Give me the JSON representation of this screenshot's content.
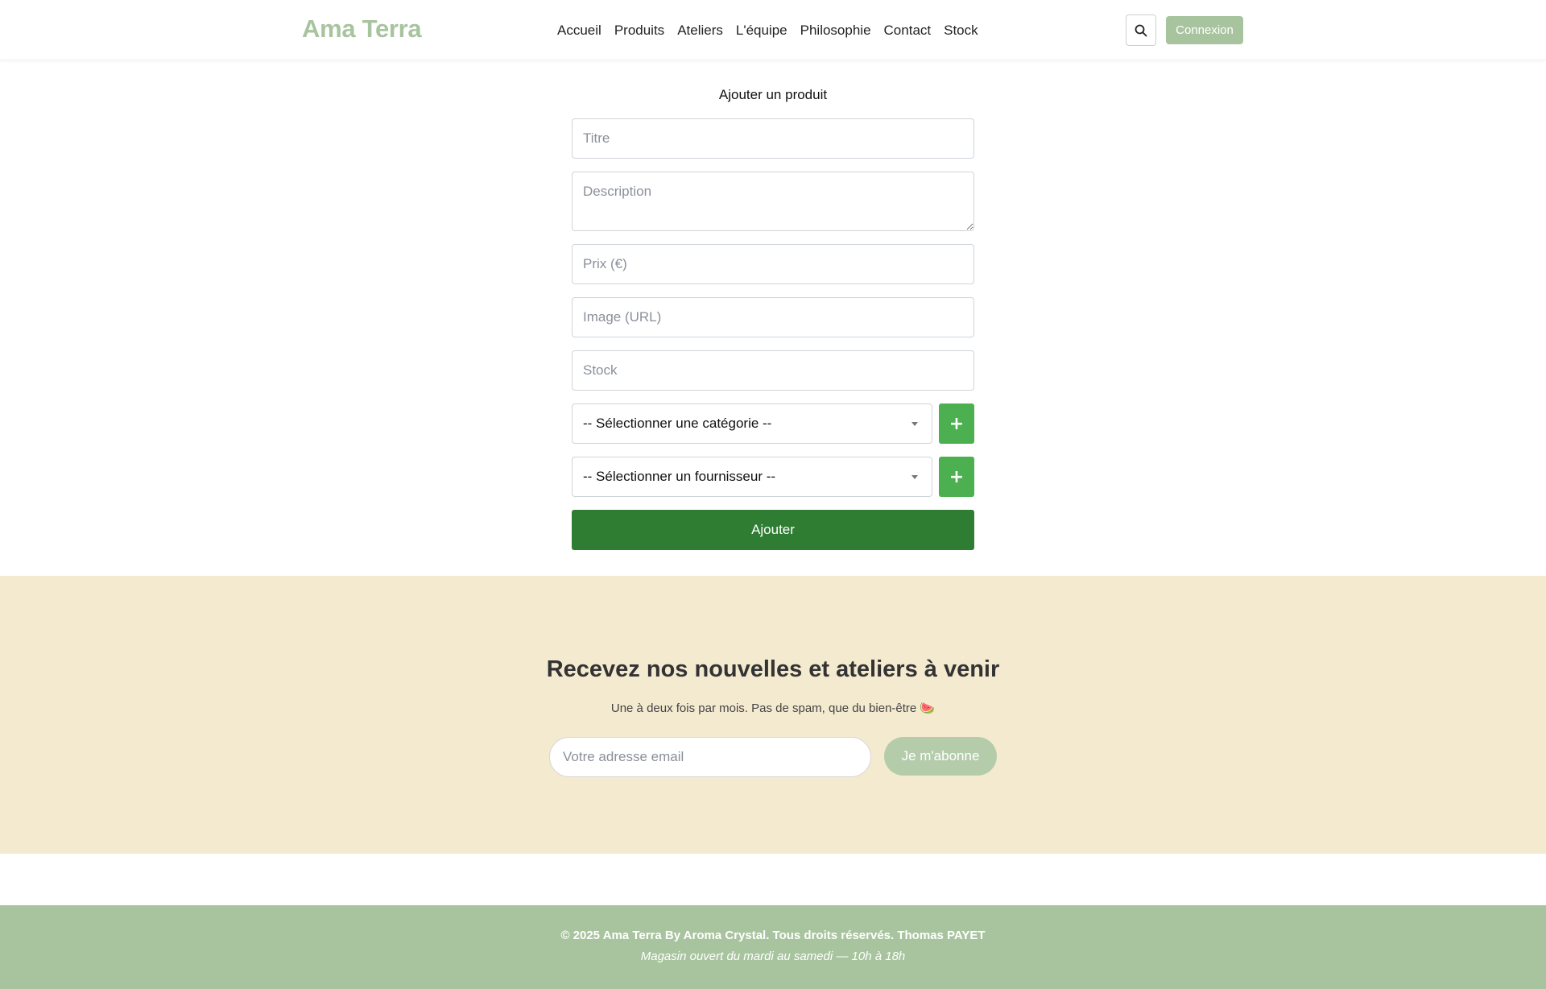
{
  "header": {
    "logo": "Ama Terra",
    "nav": [
      "Accueil",
      "Produits",
      "Ateliers",
      "L'équipe",
      "Philosophie",
      "Contact",
      "Stock"
    ],
    "search_icon": "search-icon",
    "login_label": "Connexion"
  },
  "form": {
    "title": "Ajouter un produit",
    "title_placeholder": "Titre",
    "description_placeholder": "Description",
    "price_placeholder": "Prix (€)",
    "image_placeholder": "Image (URL)",
    "stock_placeholder": "Stock",
    "category_select": "-- Sélectionner une catégorie --",
    "supplier_select": "-- Sélectionner un fournisseur --",
    "add_category_label": "+",
    "add_supplier_label": "+",
    "submit_label": "Ajouter"
  },
  "newsletter": {
    "title": "Recevez nos nouvelles et ateliers à venir",
    "subtitle": "Une à deux fois par mois. Pas de spam, que du bien-être 🍉",
    "email_placeholder": "Votre adresse email",
    "subscribe_label": "Je m'abonne"
  },
  "footer": {
    "copyright": "© 2025 Ama Terra By Aroma Crystal. Tous droits réservés. Thomas PAYET",
    "hours": "Magasin ouvert du mardi au samedi — 10h à 18h"
  },
  "colors": {
    "brand_green_light": "#a8c49e",
    "button_green": "#4caf50",
    "button_green_dark": "#2e7d32",
    "newsletter_bg": "#f4ead0"
  }
}
